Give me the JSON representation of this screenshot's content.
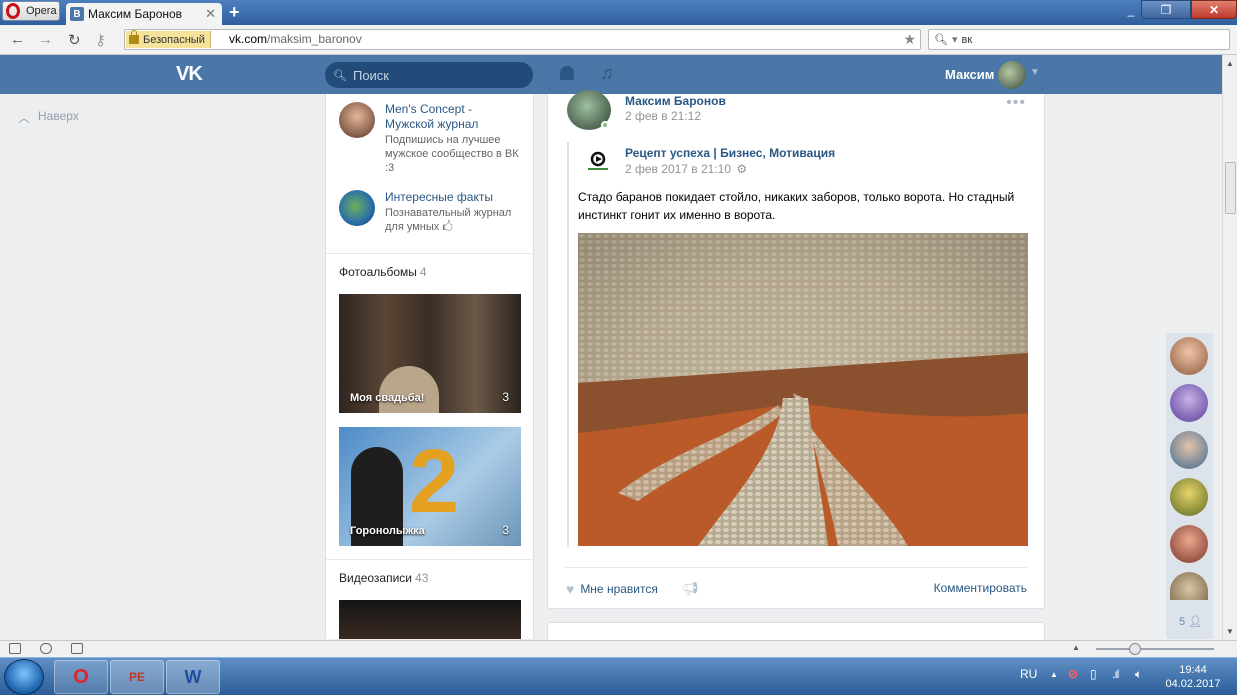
{
  "browser": {
    "menu_label": "Opera",
    "tab_title": "Максим Баронов",
    "tab_favicon": "B",
    "security_label": "Безопасный",
    "url_host": "vk.com",
    "url_path": "/maksim_baronov",
    "search_text": "вк"
  },
  "vk": {
    "logo": "VK",
    "search_placeholder": "Поиск",
    "user_name": "Максим",
    "back_to_top": "Наверх"
  },
  "subscriptions": [
    {
      "name": "Men's Concept - Мужской журнал",
      "desc": "Подпишись на лучшее мужское сообщество в ВК :3"
    },
    {
      "name": "Интересные факты",
      "desc": "Познавательный журнал для умных 🖒"
    }
  ],
  "albums": {
    "title": "Фотоальбомы",
    "count": "4",
    "items": [
      {
        "caption": "Моя свадьба!",
        "count": "3"
      },
      {
        "caption": "Горонолыжка",
        "count": "3"
      }
    ]
  },
  "videos": {
    "title": "Видеозаписи",
    "count": "43"
  },
  "post": {
    "author": "Максим Баронов",
    "date": "2 фев в 21:12",
    "more": "•••",
    "repost_source": "Рецепт успеха | Бизнес, Мотивация",
    "repost_date": "2 фев 2017 в 21:10",
    "text": "Стадо баранов покидает стойло, никаких заборов, только ворота. Но стадный инстинкт гонит их именно в ворота.",
    "like_label": "Мне нравится",
    "comment_label": "Комментировать"
  },
  "friends_online": {
    "count": "5"
  },
  "taskbar": {
    "lang": "RU",
    "time": "19:44",
    "date": "04.02.2017",
    "apps": [
      "O",
      "PE",
      "W"
    ]
  },
  "colors": {
    "vk_blue": "#4a76a8",
    "link": "#2a5885",
    "page_bg": "#edeef0"
  }
}
